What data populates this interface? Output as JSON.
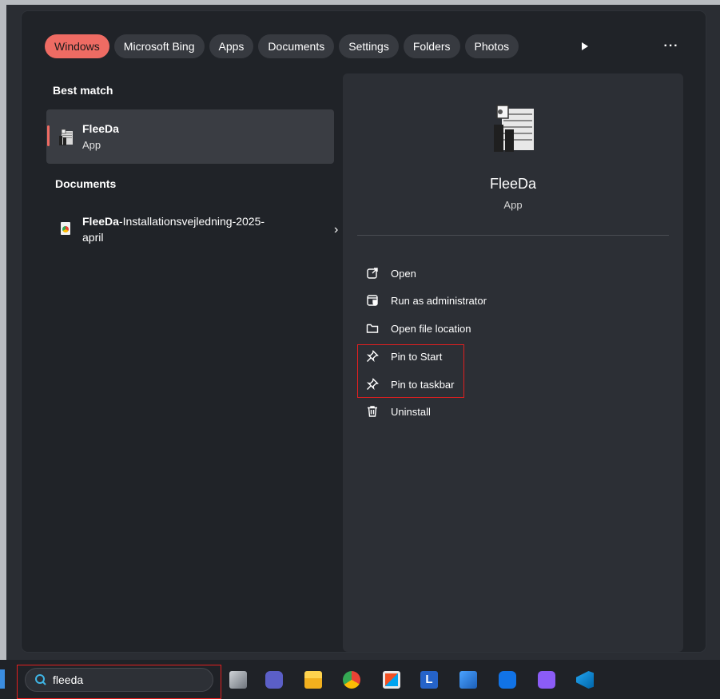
{
  "filters": {
    "tabs": [
      "Windows",
      "Microsoft Bing",
      "Apps",
      "Documents",
      "Settings",
      "Folders",
      "Photos"
    ],
    "more_label": "▶",
    "overflow_label": "···"
  },
  "results": {
    "best_match_heading": "Best match",
    "best_match": {
      "name": "FleeDa",
      "type": "App"
    },
    "documents_heading": "Documents",
    "document": {
      "name_bold": "FleeDa",
      "name_rest": "-Installationsvejledning-2025-april",
      "chevron": "›"
    }
  },
  "details": {
    "app_name": "FleeDa",
    "app_type": "App",
    "actions": [
      "Open",
      "Run as administrator",
      "Open file location",
      "Pin to Start",
      "Pin to taskbar",
      "Uninstall"
    ]
  },
  "taskbar": {
    "search_value": "fleeda",
    "icons": [
      "task-view-icon",
      "teams-icon",
      "file-explorer-icon",
      "chrome-icon",
      "microsoft-store-icon",
      "l-app-icon",
      "remote-desktop-icon",
      "teamviewer-icon",
      "purple-app-icon",
      "vscode-icon"
    ]
  },
  "colors": {
    "accent": "#ee6b63",
    "highlight_box": "#e21f1f",
    "panel": "#202328",
    "pane": "#2c2f35"
  }
}
